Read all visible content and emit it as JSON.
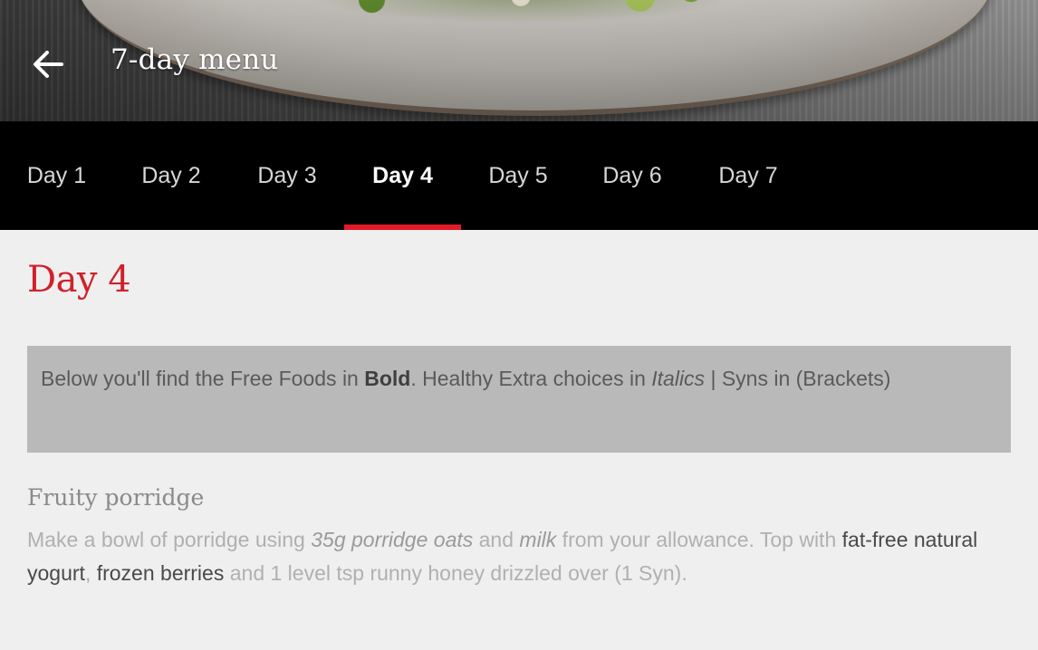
{
  "header": {
    "title": "7-day menu",
    "back_icon": "arrow-left-icon"
  },
  "tabs": [
    {
      "label": "Day 1",
      "active": false
    },
    {
      "label": "Day 2",
      "active": false
    },
    {
      "label": "Day 3",
      "active": false
    },
    {
      "label": "Day 4",
      "active": true
    },
    {
      "label": "Day 5",
      "active": false
    },
    {
      "label": "Day 6",
      "active": false
    },
    {
      "label": "Day 7",
      "active": false
    }
  ],
  "colors": {
    "accent": "#e21a27",
    "heading_red": "#d0202a",
    "tab_bar": "#000000",
    "info_box": "#b9b9b9",
    "page_bg": "#efefef"
  },
  "content": {
    "day_title": "Day 4",
    "info": {
      "part1": "Below you'll find the Free Foods in ",
      "bold_word": "Bold",
      "part2": ". Healthy Extra choices in ",
      "italic_word": "Italics",
      "part3": " |  Syns in (Brackets)"
    },
    "meals": [
      {
        "title": "Fruity porridge",
        "desc": {
          "s1": "Make a bowl of porridge using ",
          "i1": "35g porridge oats",
          "s2": " and ",
          "i2": "milk",
          "s3": " from your allowance. Top with ",
          "b1": "fat-free natural yogurt",
          "s4": ", ",
          "b2": "frozen berries",
          "s5": " and 1 level tsp runny honey drizzled over (1 Syn)."
        }
      }
    ]
  }
}
